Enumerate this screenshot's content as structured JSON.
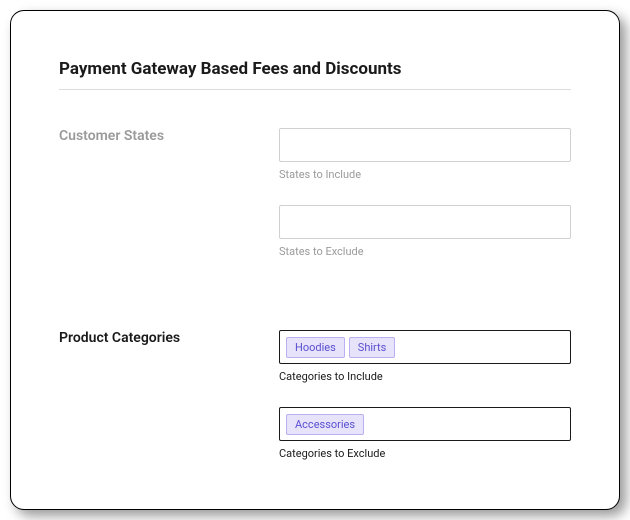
{
  "header": {
    "title": "Payment Gateway Based Fees and Discounts"
  },
  "sections": {
    "customerStates": {
      "label": "Customer States",
      "include": {
        "helper": "States to Include",
        "value": ""
      },
      "exclude": {
        "helper": "States to Exclude",
        "value": ""
      }
    },
    "productCategories": {
      "label": "Product Categories",
      "include": {
        "helper": "Categories to Include",
        "tags": [
          "Hoodies",
          "Shirts"
        ]
      },
      "exclude": {
        "helper": "Categories to Exclude",
        "tags": [
          "Accessories"
        ]
      }
    }
  }
}
